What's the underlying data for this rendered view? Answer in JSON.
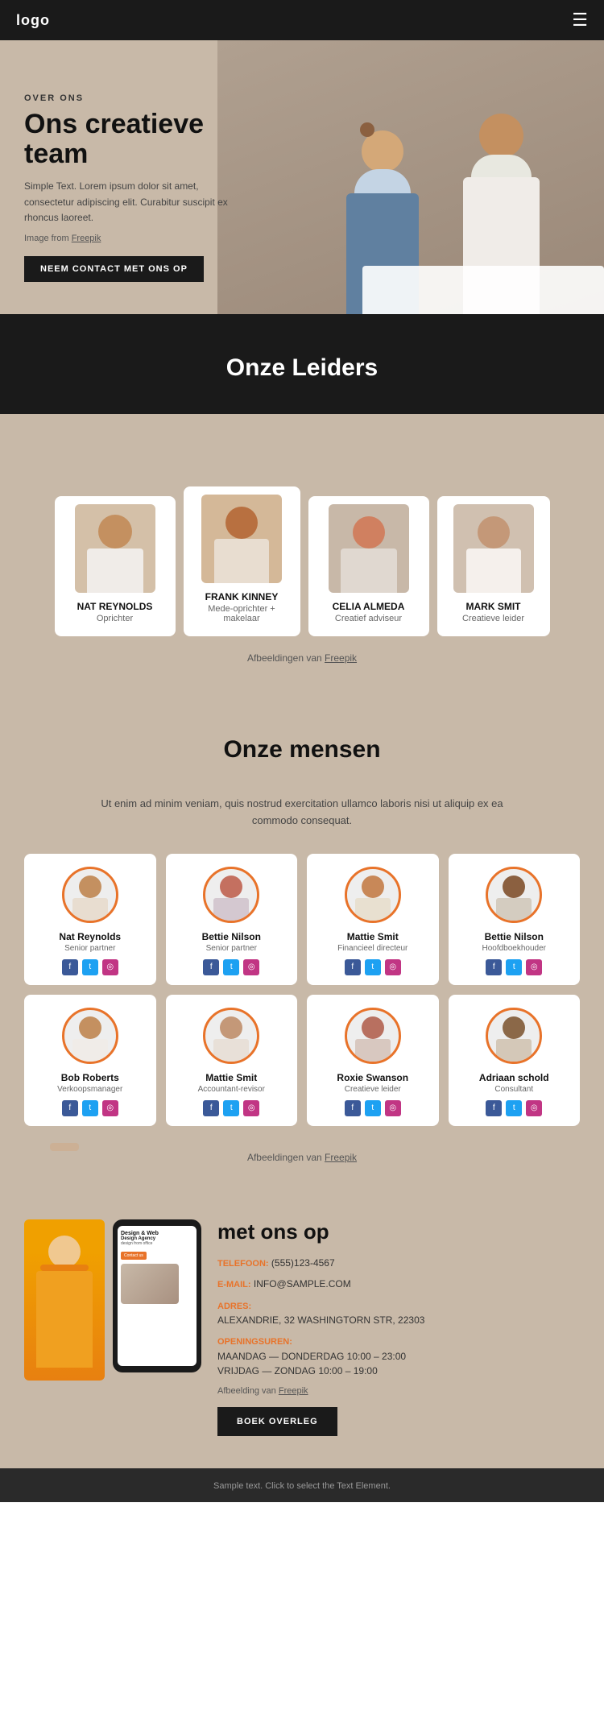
{
  "navbar": {
    "logo": "logo",
    "hamburger_icon": "☰"
  },
  "hero": {
    "label": "OVER ONS",
    "title": "Ons creatieve team",
    "text": "Simple Text. Lorem ipsum dolor sit amet, consectetur adipiscing elit. Curabitur suscipit ex rhoncus laoreet.",
    "image_credit_prefix": "Image from ",
    "image_credit_link": "Freepik",
    "button_label": "NEEM CONTACT MET ONS OP"
  },
  "leaders": {
    "section_title": "Onze Leiders",
    "people": [
      {
        "name": "NAT REYNOLDS",
        "role": "Oprichter"
      },
      {
        "name": "FRANK KINNEY",
        "role": "Mede-oprichter + makelaar"
      },
      {
        "name": "CELIA ALMEDA",
        "role": "Creatief adviseur"
      },
      {
        "name": "MARK SMIT",
        "role": "Creatieve leider"
      }
    ],
    "credit_prefix": "Afbeeldingen van ",
    "credit_link": "Freepik"
  },
  "team": {
    "section_title": "Onze mensen",
    "subtitle": "Ut enim ad minim veniam, quis nostrud exercitation ullamco laboris nisi ut aliquip ex ea commodo consequat.",
    "members": [
      {
        "name": "Nat Reynolds",
        "role": "Senior partner"
      },
      {
        "name": "Bettie Nilson",
        "role": "Senior partner"
      },
      {
        "name": "Mattie Smit",
        "role": "Financieel directeur"
      },
      {
        "name": "Bettie Nilson",
        "role": "Hoofdboekhouder"
      },
      {
        "name": "Bob Roberts",
        "role": "Verkoopsmanager"
      },
      {
        "name": "Mattie Smit",
        "role": "Accountant-revisor"
      },
      {
        "name": "Roxie Swanson",
        "role": "Creatieve leider"
      },
      {
        "name": "Adriaan schold",
        "role": "Consultant"
      }
    ],
    "credit_prefix": "Afbeeldingen van ",
    "credit_link": "Freepik"
  },
  "contact": {
    "title": "met ons op",
    "phone_label": "TELEFOON:",
    "phone_value": "(555)123-4567",
    "email_label": "E-MAIL:",
    "email_value": "INFO@SAMPLE.COM",
    "address_label": "ADRES:",
    "address_value": "ALEXANDRIE, 32 WASHINGTORN STR, 22303",
    "hours_label": "OPENINGSUREN:",
    "hours_value1": "MAANDAG — DONDERDAG 10:00 – 23:00",
    "hours_value2": "VRIJDAG — ZONDAG 10:00 – 19:00",
    "credit_prefix": "Afbeelding van ",
    "credit_link": "Freepik",
    "button_label": "BOEK OVERLEG",
    "phone_screen_title": "Design & Web",
    "phone_screen_sub2": "Design Agency",
    "phone_screen_text": "design from office",
    "phone_screen_btn": "Contact us"
  },
  "footer": {
    "text": "Sample text. Click to select the Text Element."
  },
  "colors": {
    "accent": "#e8732a",
    "dark": "#1a1a1a",
    "bg_warm": "#c8b9a8"
  }
}
